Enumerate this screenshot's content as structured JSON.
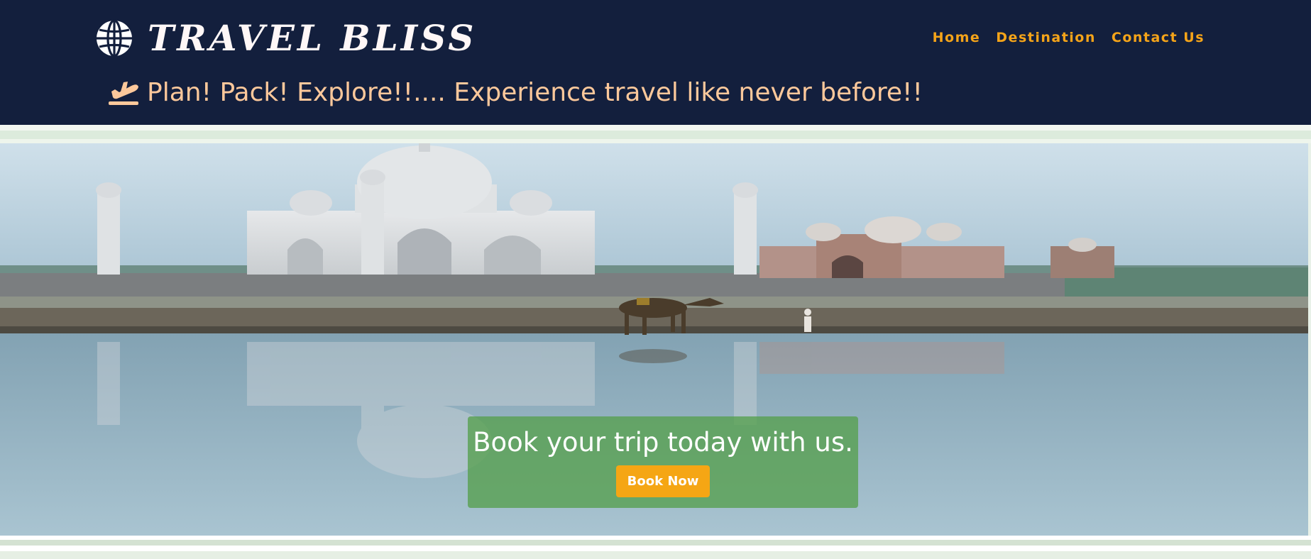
{
  "header": {
    "brand": {
      "name": "TRAVEL BLISS",
      "icon": "globe-icon"
    },
    "nav": [
      {
        "label": "Home"
      },
      {
        "label": "Destination"
      },
      {
        "label": "Contact Us"
      }
    ],
    "tagline": {
      "icon": "airplane-departure-icon",
      "text": "Plan! Pack! Explore!!.... Experience travel like never before!!"
    }
  },
  "hero": {
    "image": "taj-mahal-river-reflection-photo",
    "cta": {
      "title": "Book your trip today with us.",
      "button_label": "Book Now"
    }
  },
  "colors": {
    "header_bg": "#131f3d",
    "nav_link": "#f5a419",
    "tagline": "#fcc89b",
    "cta_box": "#58a050",
    "cta_button": "#f5a614"
  }
}
